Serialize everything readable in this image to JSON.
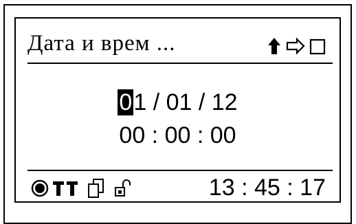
{
  "header": {
    "title": "Дата и врем ...",
    "icons": [
      "arrow-up-icon",
      "arrow-right-icon",
      "checkbox-icon"
    ]
  },
  "editor": {
    "date_cursor_digit": "0",
    "date_rest": "1 / 01 / 12",
    "time": "00 : 00 : 00"
  },
  "status_bar": {
    "icons": [
      "record-dot-icon",
      "antenna-icon",
      "antenna-icon",
      "copy-icon",
      "unlock-icon"
    ],
    "clock": "13 : 45 : 17"
  }
}
